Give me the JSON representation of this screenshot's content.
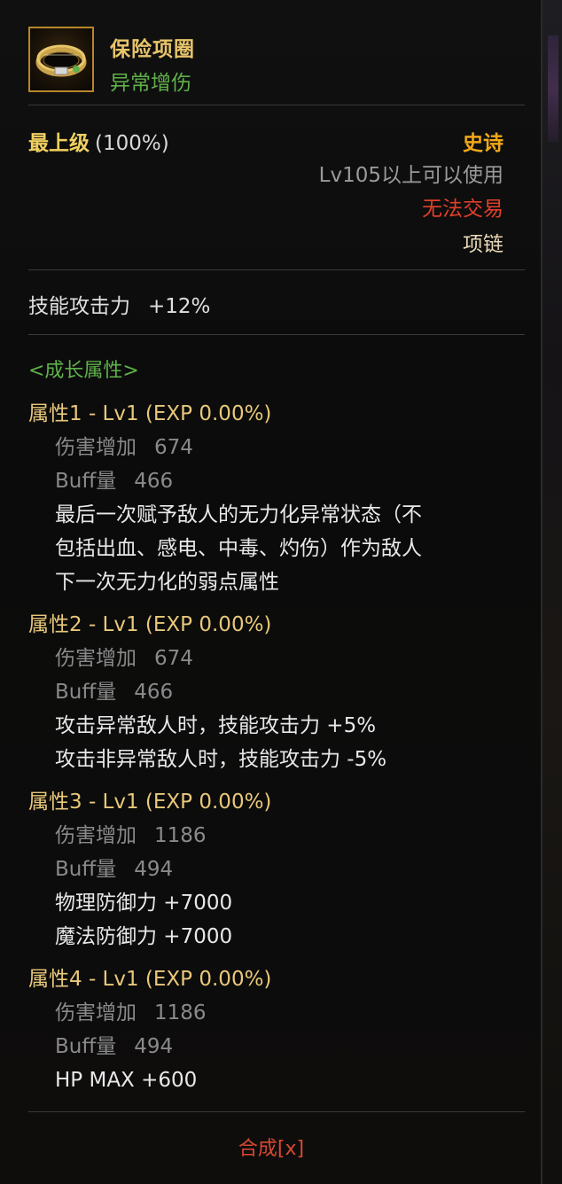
{
  "item": {
    "name": "保险项圈",
    "subtitle": "异常增伤",
    "icon": "collar-icon"
  },
  "grade": {
    "label": "最上级",
    "value": "(100%)"
  },
  "info": {
    "rarity": "史诗",
    "level_requirement": "Lv105以上可以使用",
    "tradable": "无法交易",
    "slot": "项链"
  },
  "skill": {
    "label": "技能攻击力",
    "value": "+12%"
  },
  "growth_title": "<成长属性>",
  "attributes": [
    {
      "title": "属性1 - Lv1 (EXP 0.00%)",
      "damage_label": "伤害增加",
      "damage_value": "674",
      "buff_label": "Buff量",
      "buff_value": "466",
      "desc": [
        "最后一次赋予敌人的无力化异常状态（不",
        "包括出血、感电、中毒、灼伤）作为敌人",
        "下一次无力化的弱点属性"
      ]
    },
    {
      "title": "属性2 - Lv1 (EXP 0.00%)",
      "damage_label": "伤害增加",
      "damage_value": "674",
      "buff_label": "Buff量",
      "buff_value": "466",
      "desc": [
        "攻击异常敌人时，技能攻击力 +5%",
        "攻击非异常敌人时，技能攻击力 -5%"
      ]
    },
    {
      "title": "属性3 - Lv1 (EXP 0.00%)",
      "damage_label": "伤害增加",
      "damage_value": "1186",
      "buff_label": "Buff量",
      "buff_value": "494",
      "desc": [
        "物理防御力 +7000",
        "魔法防御力 +7000"
      ]
    },
    {
      "title": "属性4 - Lv1 (EXP 0.00%)",
      "damage_label": "伤害增加",
      "damage_value": "1186",
      "buff_label": "Buff量",
      "buff_value": "494",
      "desc": [
        "HP MAX +600"
      ]
    }
  ],
  "synth_label": "合成[x]",
  "colors": {
    "name": "#e8c46a",
    "subtitle": "#5fb04a",
    "rarity": "#f0a818",
    "untradable": "#e0402a",
    "attr_title": "#e8c87a",
    "synth": "#d84830"
  }
}
